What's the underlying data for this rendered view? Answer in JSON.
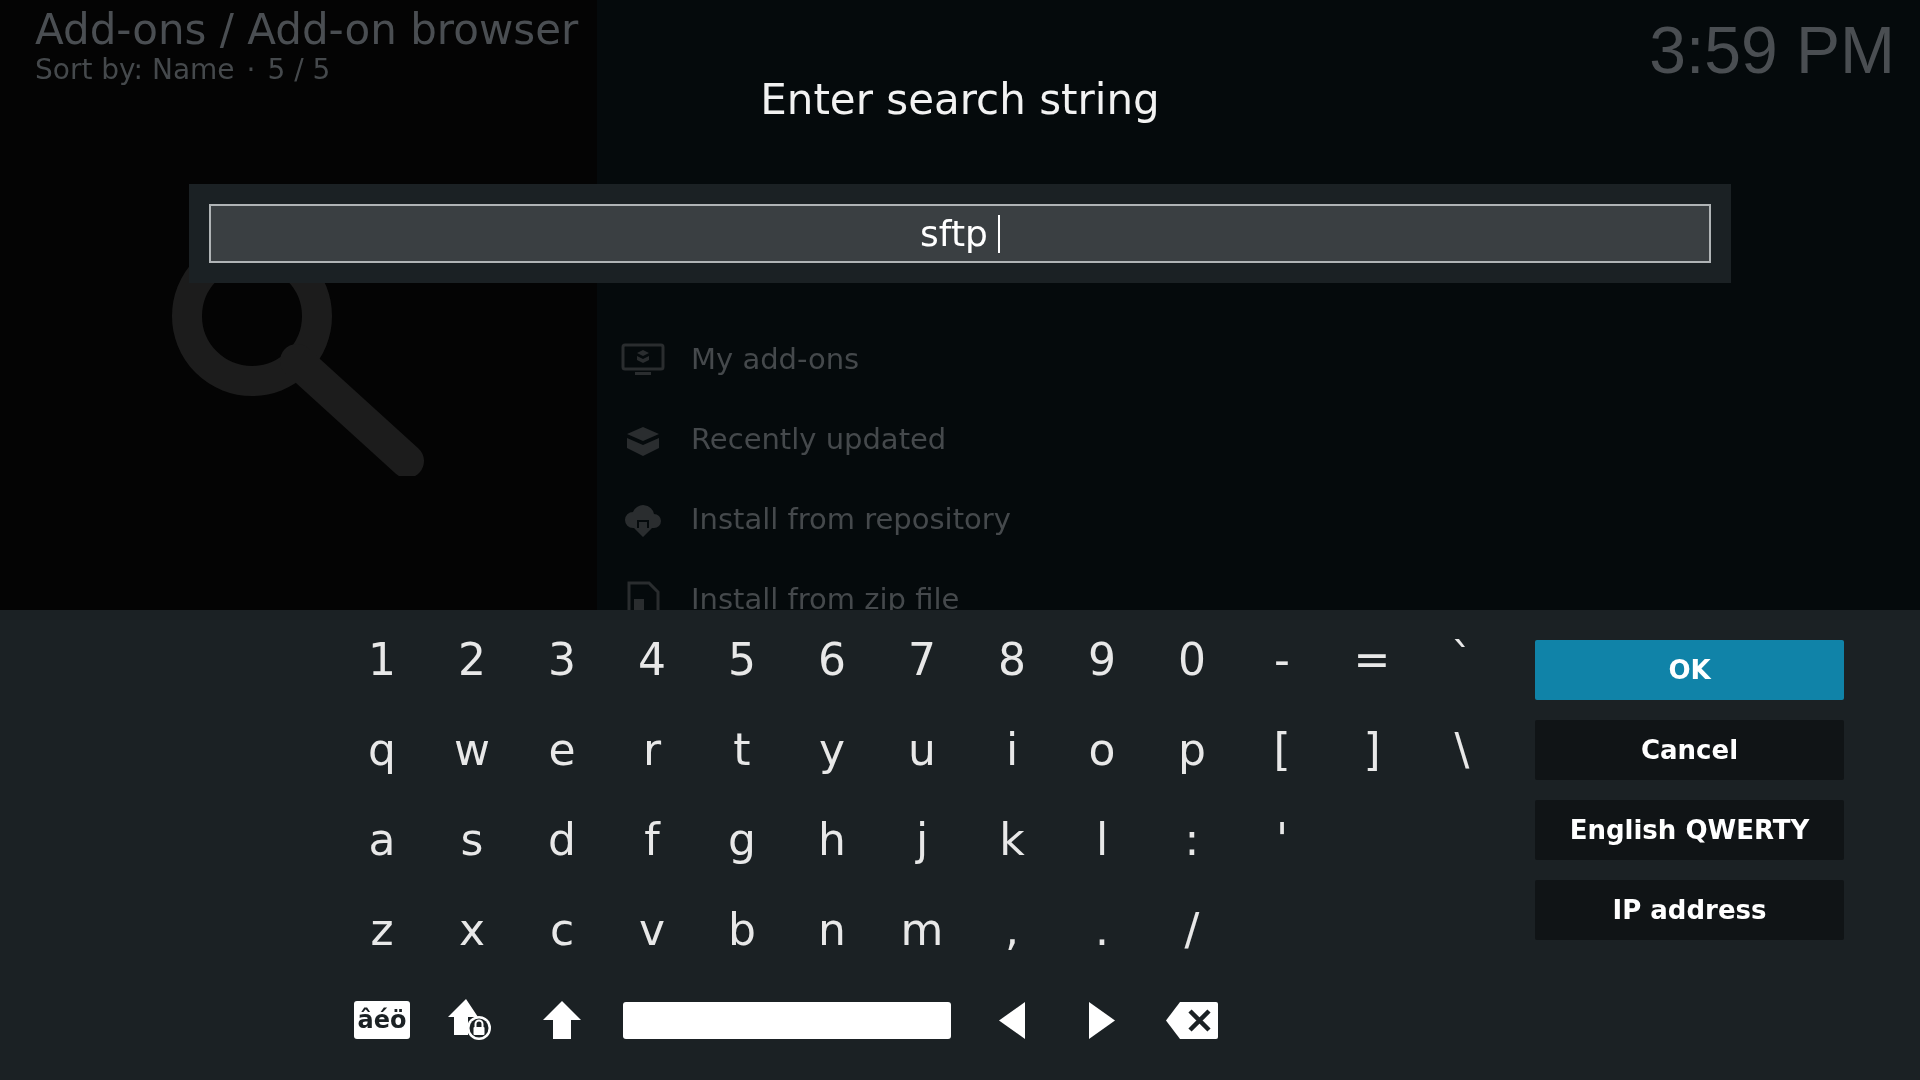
{
  "header": {
    "title": "Add-ons / Add-on browser",
    "sort": "Sort by: Name",
    "separator": "·",
    "count": "5 / 5",
    "time": "3:59 PM"
  },
  "menu": [
    {
      "label": "My add-ons",
      "kind": "monitor"
    },
    {
      "label": "Recently updated",
      "kind": "box"
    },
    {
      "label": "Install from repository",
      "kind": "cloud"
    },
    {
      "label": "Install from zip file",
      "kind": "zip"
    }
  ],
  "dialog": {
    "title": "Enter search string",
    "value": "sftp"
  },
  "keyboard": {
    "rows": [
      [
        "1",
        "2",
        "3",
        "4",
        "5",
        "6",
        "7",
        "8",
        "9",
        "0",
        "-",
        "=",
        "`"
      ],
      [
        "q",
        "w",
        "e",
        "r",
        "t",
        "y",
        "u",
        "i",
        "o",
        "p",
        "[",
        "]",
        "\\"
      ],
      [
        "a",
        "s",
        "d",
        "f",
        "g",
        "h",
        "j",
        "k",
        "l",
        ":",
        "'"
      ],
      [
        "z",
        "x",
        "c",
        "v",
        "b",
        "n",
        "m",
        ",",
        ".",
        "/"
      ]
    ],
    "special": [
      {
        "kind": "symbols",
        "label": "âéö"
      },
      {
        "kind": "capslock"
      },
      {
        "kind": "shift"
      },
      {
        "kind": "space"
      },
      {
        "kind": "left"
      },
      {
        "kind": "right"
      },
      {
        "kind": "backspace"
      }
    ]
  },
  "buttons": [
    {
      "label": "OK",
      "selected": true
    },
    {
      "label": "Cancel",
      "selected": false
    },
    {
      "label": "English QWERTY",
      "selected": false
    },
    {
      "label": "IP address",
      "selected": false
    }
  ]
}
